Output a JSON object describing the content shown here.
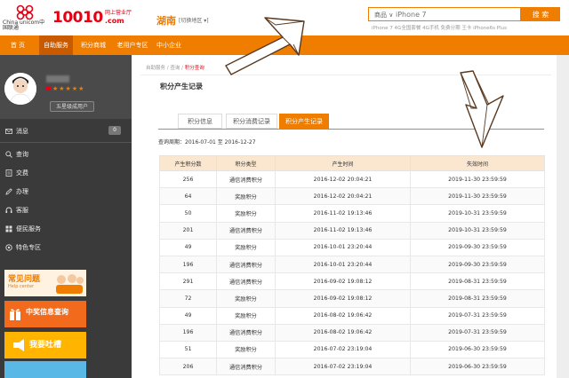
{
  "header": {
    "logo_text": "China unicom中国联通",
    "brand": "10010",
    "brand_sub": "网上营业厅",
    "brand_com": ".com",
    "region": "湖南",
    "region_switch": "[切换地区 ▾]",
    "search": {
      "category": "商品 ∨",
      "placeholder": "iPhone 7",
      "button": "搜 索"
    },
    "hot_words": "iPhone 7  4G全国套餐  4G手机  免费分期  王卡  iPhone6s Plus"
  },
  "nav": {
    "items": [
      {
        "label": "首 页"
      },
      {
        "label": "自助服务"
      },
      {
        "label": "积分商城"
      },
      {
        "label": "老用户专区"
      },
      {
        "label": "中小企业"
      }
    ]
  },
  "sidebar": {
    "stars": "★★★★★",
    "level": "五星级成用户",
    "messages_label": "消息",
    "messages_count": "0",
    "menu": [
      {
        "label": "查询"
      },
      {
        "label": "交费"
      },
      {
        "label": "办理"
      },
      {
        "label": "客服"
      },
      {
        "label": "便民服务"
      },
      {
        "label": "特色专区"
      }
    ],
    "banners": {
      "faq": "常见问题",
      "faq_sub": "Help center",
      "winner": "中奖信息查询",
      "complaint": "我要吐槽"
    }
  },
  "content": {
    "breadcrumb": {
      "home": "自助服务",
      "sep1": " / ",
      "query": "查询",
      "sep2": " / ",
      "current": "积分查询"
    },
    "title": "积分产生记录",
    "tabs": [
      {
        "label": "积分信息"
      },
      {
        "label": "积分消费记录"
      },
      {
        "label": "积分产生记录"
      }
    ],
    "period": "查询周期：2016-07-01 至 2016-12-27",
    "table": {
      "headers": [
        "产生积分数",
        "积分类型",
        "产生时间",
        "失效时间"
      ],
      "rows": [
        [
          "256",
          "通信消费积分",
          "2016-12-02 20:04:21",
          "2019-11-30 23:59:59"
        ],
        [
          "64",
          "奖励积分",
          "2016-12-02 20:04:21",
          "2019-11-30 23:59:59"
        ],
        [
          "50",
          "奖励积分",
          "2016-11-02 19:13:46",
          "2019-10-31 23:59:59"
        ],
        [
          "201",
          "通信消费积分",
          "2016-11-02 19:13:46",
          "2019-10-31 23:59:59"
        ],
        [
          "49",
          "奖励积分",
          "2016-10-01 23:20:44",
          "2019-09-30 23:59:59"
        ],
        [
          "196",
          "通信消费积分",
          "2016-10-01 23:20:44",
          "2019-09-30 23:59:59"
        ],
        [
          "291",
          "通信消费积分",
          "2016-09-02 19:08:12",
          "2019-08-31 23:59:59"
        ],
        [
          "72",
          "奖励积分",
          "2016-09-02 19:08:12",
          "2019-08-31 23:59:59"
        ],
        [
          "49",
          "奖励积分",
          "2016-08-02 19:06:42",
          "2019-07-31 23:59:59"
        ],
        [
          "196",
          "通信消费积分",
          "2016-08-02 19:06:42",
          "2019-07-31 23:59:59"
        ],
        [
          "51",
          "奖励积分",
          "2016-07-02 23:19:04",
          "2019-06-30 23:59:59"
        ],
        [
          "206",
          "通信消费积分",
          "2016-07-02 23:19:04",
          "2019-06-30 23:59:59"
        ]
      ]
    }
  },
  "colors": {
    "accent": "#ef7d00",
    "brand_red": "#e60012",
    "sidebar": "#3a3a3a"
  }
}
